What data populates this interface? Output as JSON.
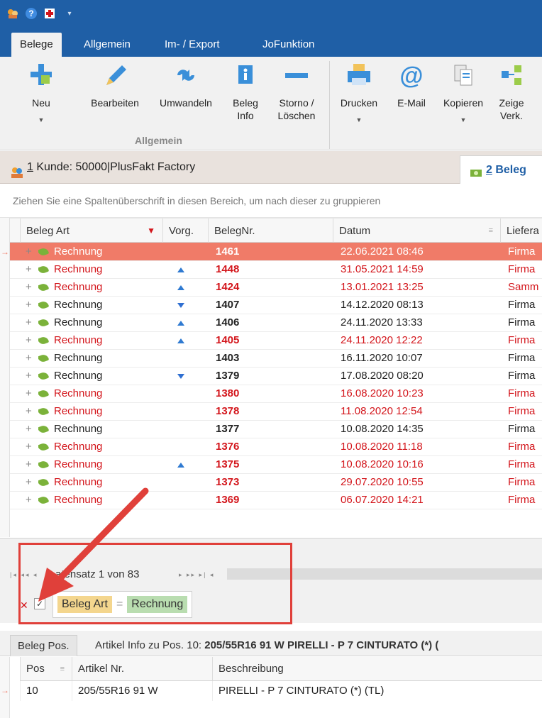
{
  "tabs": [
    {
      "label": "Belege",
      "active": true
    },
    {
      "label": "Allgemein"
    },
    {
      "label": "Im- / Export"
    },
    {
      "label": "JoFunktion"
    }
  ],
  "ribbon": {
    "buttons": [
      {
        "label": "Neu",
        "icon": "plus-icon",
        "dropdown": true
      },
      {
        "label": "Bearbeiten",
        "icon": "pencil-icon"
      },
      {
        "label": "Umwandeln",
        "icon": "convert-icon"
      },
      {
        "label": "Beleg Info",
        "line1": "Beleg",
        "line2": "Info",
        "icon": "info-icon"
      },
      {
        "label": "Storno / Löschen",
        "line1": "Storno /",
        "line2": "Löschen",
        "icon": "minus-icon"
      },
      {
        "label": "Drucken",
        "icon": "printer-icon",
        "dropdown": true
      },
      {
        "label": "E-Mail",
        "icon": "at-icon"
      },
      {
        "label": "Kopieren",
        "icon": "copy-icon",
        "dropdown": true
      },
      {
        "label": "Zeige Verk.",
        "line1": "Zeige",
        "line2": "Verk.",
        "icon": "link-icon"
      }
    ],
    "group_label": "Allgemein"
  },
  "doc_tabs": {
    "tab1": "1 Kunde: 50000|PlusFakt Factory",
    "tab1_num": "1",
    "tab1_rest": " Kunde: 50000|PlusFakt Factory",
    "tab2": "2 Beleg",
    "tab2_num": "2",
    "tab2_rest": " Beleg"
  },
  "group_hint": "Ziehen Sie eine Spaltenüberschrift in diesen Bereich, um nach dieser zu gruppieren",
  "grid": {
    "columns": [
      "Beleg Art",
      "Vorg.",
      "BelegNr.",
      "Datum",
      "Lieferа"
    ],
    "rows": [
      {
        "art": "Rechnung",
        "vorg": "",
        "nr": "1461",
        "datum": "22.06.2021 08:46",
        "liefer": "Firma",
        "red": true,
        "selected": true
      },
      {
        "art": "Rechnung",
        "vorg": "up",
        "nr": "1448",
        "datum": "31.05.2021 14:59",
        "liefer": "Firma",
        "red": true
      },
      {
        "art": "Rechnung",
        "vorg": "up",
        "nr": "1424",
        "datum": "13.01.2021 13:25",
        "liefer": "Samm",
        "red": true
      },
      {
        "art": "Rechnung",
        "vorg": "down",
        "nr": "1407",
        "datum": "14.12.2020 08:13",
        "liefer": "Firma",
        "red": false
      },
      {
        "art": "Rechnung",
        "vorg": "up",
        "nr": "1406",
        "datum": "24.11.2020 13:33",
        "liefer": "Firma",
        "red": false
      },
      {
        "art": "Rechnung",
        "vorg": "up",
        "nr": "1405",
        "datum": "24.11.2020 12:22",
        "liefer": "Firma",
        "red": true
      },
      {
        "art": "Rechnung",
        "vorg": "",
        "nr": "1403",
        "datum": "16.11.2020 10:07",
        "liefer": "Firma",
        "red": false
      },
      {
        "art": "Rechnung",
        "vorg": "down",
        "nr": "1379",
        "datum": "17.08.2020 08:20",
        "liefer": "Firma",
        "red": false
      },
      {
        "art": "Rechnung",
        "vorg": "",
        "nr": "1380",
        "datum": "16.08.2020 10:23",
        "liefer": "Firma",
        "red": true
      },
      {
        "art": "Rechnung",
        "vorg": "",
        "nr": "1378",
        "datum": "11.08.2020 12:54",
        "liefer": "Firma",
        "red": true
      },
      {
        "art": "Rechnung",
        "vorg": "",
        "nr": "1377",
        "datum": "10.08.2020 14:35",
        "liefer": "Firma",
        "red": false
      },
      {
        "art": "Rechnung",
        "vorg": "",
        "nr": "1376",
        "datum": "10.08.2020 11:18",
        "liefer": "Firma",
        "red": true
      },
      {
        "art": "Rechnung",
        "vorg": "up",
        "nr": "1375",
        "datum": "10.08.2020 10:16",
        "liefer": "Firma",
        "red": true
      },
      {
        "art": "Rechnung",
        "vorg": "",
        "nr": "1373",
        "datum": "29.07.2020 10:55",
        "liefer": "Firma",
        "red": true
      },
      {
        "art": "Rechnung",
        "vorg": "",
        "nr": "1369",
        "datum": "06.07.2020 14:21",
        "liefer": "Firma",
        "red": true
      }
    ]
  },
  "navigator": {
    "text": "atensatz 1 von 83"
  },
  "filter": {
    "field": "Beleg Art",
    "op": "=",
    "value": "Rechnung"
  },
  "bottom_tabs": {
    "tab1": "Beleg Pos.",
    "tab2_prefix": "Artikel Info zu Pos. 10: ",
    "tab2_bold": "205/55R16 91 W PIRELLI - P 7 CINTURATO (*) ("
  },
  "positions": {
    "columns": [
      "Pos",
      "Artikel Nr.",
      "Beschreibung"
    ],
    "rows": [
      {
        "pos": "10",
        "artikel": "205/55R16 91 W",
        "beschreibung": "PIRELLI - P 7 CINTURATO (*) (TL)"
      }
    ]
  },
  "colors": {
    "accent": "#1f5fa6",
    "selected_row": "#f07b68",
    "red_text": "#d3151b",
    "annotation": "#e0403a"
  }
}
